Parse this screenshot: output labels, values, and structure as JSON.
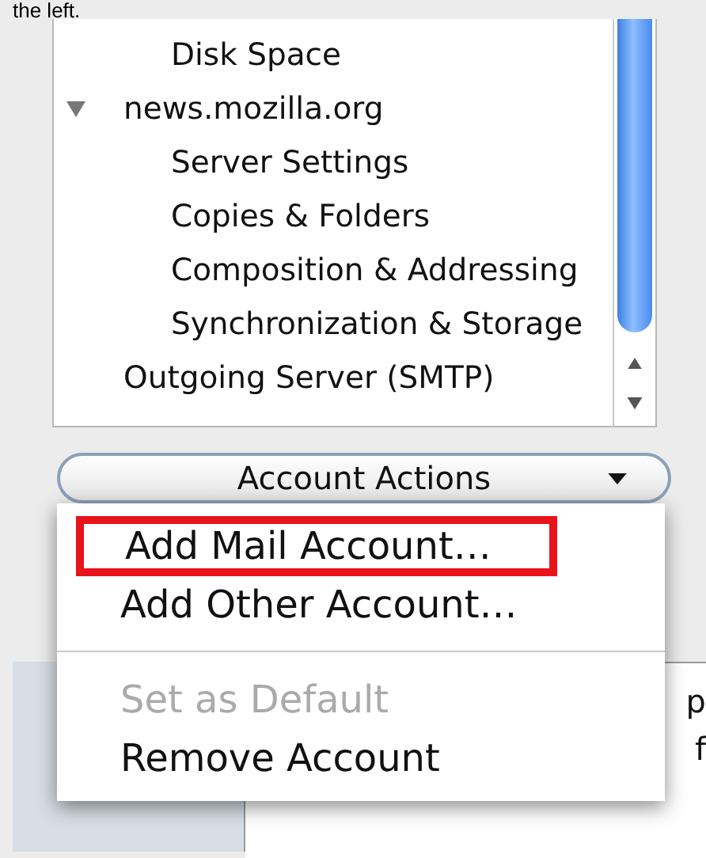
{
  "caption": "the left.",
  "tree": [
    {
      "children": [
        {
          "label": "Disk Space"
        }
      ]
    },
    {
      "label": "news.mozilla.org",
      "expanded": true,
      "children": [
        {
          "label": "Server Settings"
        },
        {
          "label": "Copies & Folders"
        },
        {
          "label": "Composition & Addressing"
        },
        {
          "label": "Synchronization & Storage"
        }
      ]
    },
    {
      "label": "Outgoing Server (SMTP)"
    }
  ],
  "actions_button": {
    "label": "Account Actions"
  },
  "menu": [
    {
      "kind": "item",
      "label": "Add Mail Account…",
      "disabled": false,
      "outlined": true
    },
    {
      "kind": "item",
      "label": "Add Other Account…",
      "disabled": false,
      "outlined": false
    },
    {
      "kind": "separator"
    },
    {
      "kind": "item",
      "label": "Set as Default",
      "disabled": true,
      "outlined": false
    },
    {
      "kind": "item",
      "label": "Remove Account",
      "disabled": false,
      "outlined": false
    }
  ],
  "background_text": [
    "p",
    "f"
  ]
}
